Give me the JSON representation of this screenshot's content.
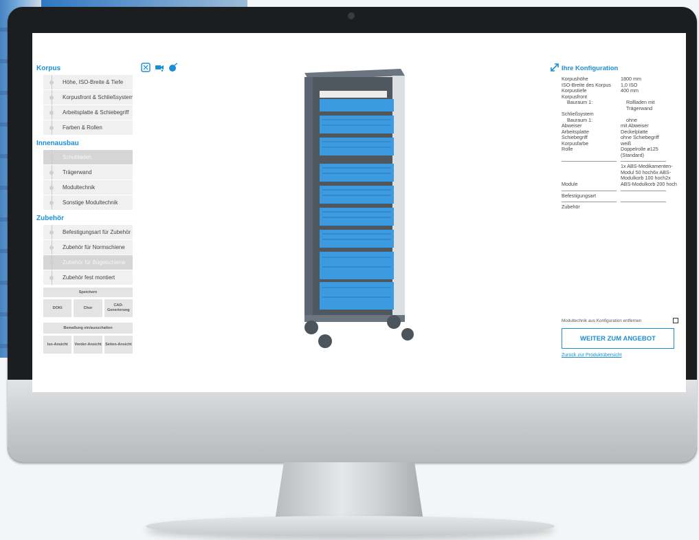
{
  "colors": {
    "accent": "#1a8fd6",
    "drawer": "#3b9ae0"
  },
  "sidebar": {
    "sections": [
      {
        "title": "Korpus",
        "items": [
          {
            "label": "Höhe, ISO-Breite & Tiefe",
            "active": false
          },
          {
            "label": "Korpusfront & Schließsystem",
            "active": false
          },
          {
            "label": "Arbeitsplatte & Schiebegriff",
            "active": false
          },
          {
            "label": "Farben & Rollen",
            "active": false
          }
        ]
      },
      {
        "title": "Innenausbau",
        "items": [
          {
            "label": "Schubladen",
            "active": true
          },
          {
            "label": "Trägerwand",
            "active": false
          },
          {
            "label": "Modultechnik",
            "active": false
          },
          {
            "label": "Sonstige Modultechnik",
            "active": false
          }
        ]
      },
      {
        "title": "Zubehör",
        "items": [
          {
            "label": "Befestigungsart für Zubehör",
            "active": false
          },
          {
            "label": "Zubehör für Normschiene",
            "active": false
          },
          {
            "label": "Zubehör für Bügelschiene",
            "active": true
          },
          {
            "label": "Zubehör fest montiert",
            "active": false
          }
        ]
      }
    ],
    "save_label": "Speichern",
    "export_buttons": [
      "DOKI",
      "Chor",
      "CAD-Generierung"
    ],
    "toggle_label": "Bemaßung ein/ausschalten",
    "view_buttons": [
      "Iso-Ansicht",
      "Vorder-Ansicht",
      "Seiten-Ansicht"
    ]
  },
  "toolbar": {
    "icons": [
      "fullscreen-frame-icon",
      "camera-icon",
      "bomb-icon"
    ]
  },
  "config": {
    "title": "Ihre Konfiguration",
    "rows": [
      {
        "label": "Korpushöhe",
        "value": "1800 mm",
        "indent": false
      },
      {
        "label": "ISO-Breite des Korpus",
        "value": "1,0 ISO",
        "indent": false
      },
      {
        "label": "Korpustiefe",
        "value": "400 mm",
        "indent": false
      },
      {
        "label": "Korpusfront",
        "value": "",
        "indent": false
      },
      {
        "label": "Bauraum 1:",
        "value": "Rollladen mit Trägerwand",
        "indent": true
      },
      {
        "label": "Schließsystem",
        "value": "",
        "indent": false
      },
      {
        "label": "Bauraum 1:",
        "value": "ohne",
        "indent": true
      },
      {
        "label": "Abweiser",
        "value": "mit Abweiser",
        "indent": false
      },
      {
        "label": "Arbeitsplatte",
        "value": "Deckelplatte",
        "indent": false
      },
      {
        "label": "Schiebegriff",
        "value": "ohne Schiebegriff",
        "indent": false
      },
      {
        "label": "Korpusfarbe",
        "value": "weiß",
        "indent": false
      },
      {
        "label": "Rolle",
        "value": "Doppelrolle ø125 (Standard)",
        "indent": false
      }
    ],
    "module_label": "Module",
    "module_value": "1x ABS-Medikamenten-Modul 50 hoch6x ABS-Modulkorb 100 hoch2x ABS-Modulkorb 200 hoch",
    "befestigung_label": "Befestigungsart",
    "zubehoer_label": "Zubehör",
    "remove_label": "Modultechnik aus Konfiguration entfernen",
    "cta_label": "WEITER ZUM ANGEBOT",
    "back_label": "Zurück zur Produktübersicht"
  }
}
